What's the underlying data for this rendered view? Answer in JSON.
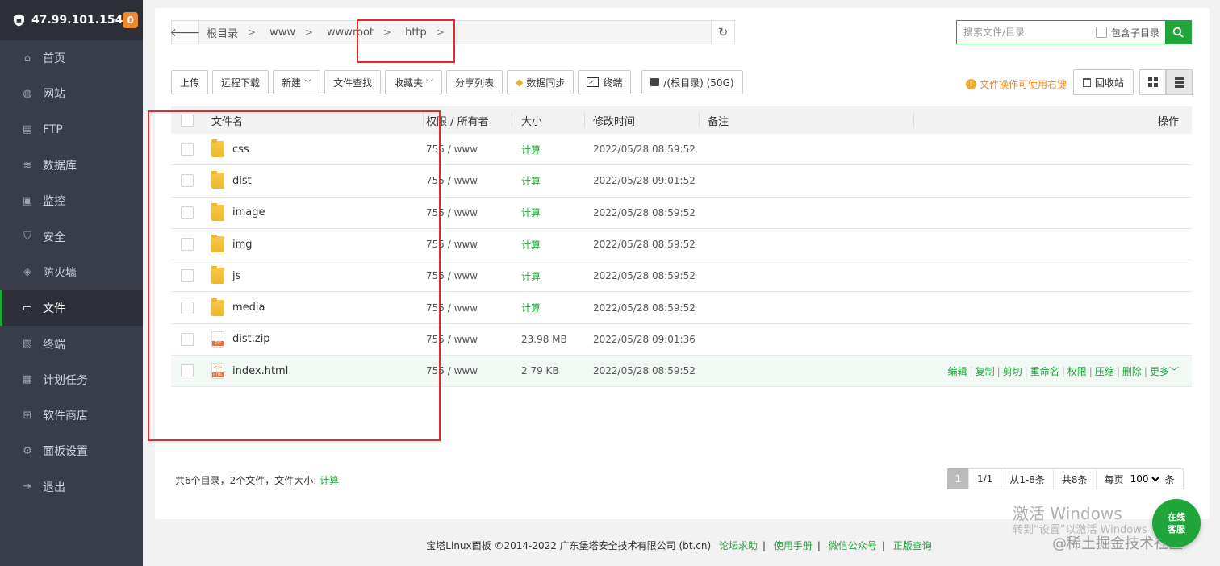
{
  "sidebar": {
    "server_ip": "47.99.101.154",
    "badge": "0",
    "items": [
      {
        "label": "首页",
        "icon": "home-icon"
      },
      {
        "label": "网站",
        "icon": "globe-icon"
      },
      {
        "label": "FTP",
        "icon": "ftp-icon"
      },
      {
        "label": "数据库",
        "icon": "database-icon"
      },
      {
        "label": "监控",
        "icon": "monitor-icon"
      },
      {
        "label": "安全",
        "icon": "shield-check-icon"
      },
      {
        "label": "防火墙",
        "icon": "firewall-shield-icon"
      },
      {
        "label": "文件",
        "icon": "folder-icon",
        "active": true
      },
      {
        "label": "终端",
        "icon": "terminal-icon"
      },
      {
        "label": "计划任务",
        "icon": "calendar-icon"
      },
      {
        "label": "软件商店",
        "icon": "apps-grid-icon"
      },
      {
        "label": "面板设置",
        "icon": "gear-icon"
      },
      {
        "label": "退出",
        "icon": "logout-icon"
      }
    ]
  },
  "breadcrumb": {
    "segments": [
      "根目录",
      "www",
      "wwwroot",
      "http"
    ]
  },
  "search": {
    "placeholder": "搜索文件/目录",
    "include_sub_label": "包含子目录"
  },
  "toolbar": {
    "upload": "上传",
    "remote_download": "远程下载",
    "new": "新建",
    "file_search": "文件查找",
    "favorites": "收藏夹",
    "share_list": "分享列表",
    "data_sync": "数据同步",
    "terminal": "终端",
    "disk": "/(根目录) (50G)",
    "tip": "文件操作可使用右键",
    "recycle": "回收站"
  },
  "table": {
    "headers": {
      "name": "文件名",
      "perm": "权限 / 所有者",
      "size": "大小",
      "mtime": "修改时间",
      "note": "备注",
      "ops": "操作"
    },
    "rows": [
      {
        "name": "css",
        "type": "folder",
        "perm": "755 / www",
        "size": "计算",
        "mtime": "2022/05/28 08:59:52"
      },
      {
        "name": "dist",
        "type": "folder",
        "perm": "755 / www",
        "size": "计算",
        "mtime": "2022/05/28 09:01:52"
      },
      {
        "name": "image",
        "type": "folder",
        "perm": "755 / www",
        "size": "计算",
        "mtime": "2022/05/28 08:59:52"
      },
      {
        "name": "img",
        "type": "folder",
        "perm": "755 / www",
        "size": "计算",
        "mtime": "2022/05/28 08:59:52"
      },
      {
        "name": "js",
        "type": "folder",
        "perm": "755 / www",
        "size": "计算",
        "mtime": "2022/05/28 08:59:52"
      },
      {
        "name": "media",
        "type": "folder",
        "perm": "755 / www",
        "size": "计算",
        "mtime": "2022/05/28 08:59:52"
      },
      {
        "name": "dist.zip",
        "type": "zip",
        "perm": "755 / www",
        "size": "23.98 MB",
        "mtime": "2022/05/28 09:01:36"
      },
      {
        "name": "index.html",
        "type": "html",
        "perm": "755 / www",
        "size": "2.79 KB",
        "mtime": "2022/05/28 08:59:52",
        "highlight": true
      }
    ],
    "row_ops": [
      "编辑",
      "复制",
      "剪切",
      "重命名",
      "权限",
      "压缩",
      "删除",
      "更多"
    ]
  },
  "summary": {
    "text": "共6个目录，2个文件，文件大小: ",
    "calc": "计算"
  },
  "pager": {
    "current": "1",
    "pages": "1/1",
    "range": "从1-8条",
    "total": "共8条",
    "per_page_label": "每页",
    "per_page": "100",
    "unit": "条"
  },
  "footer": {
    "copyright": "宝塔Linux面板 ©2014-2022 广东堡塔安全技术有限公司 (bt.cn)",
    "links": [
      "论坛求助",
      "使用手册",
      "微信公众号",
      "正版查询"
    ]
  },
  "watermark": {
    "activate_title": "激活 Windows",
    "activate_sub": "转到“设置”以激活 Windows",
    "community": "@稀土掘金技术社区"
  },
  "online_service": [
    "在线",
    "客服"
  ],
  "colors": {
    "accent": "#20a53a",
    "sidebar_bg": "#393d49",
    "annotation_red": "#e62828",
    "warning": "#f0892c"
  }
}
